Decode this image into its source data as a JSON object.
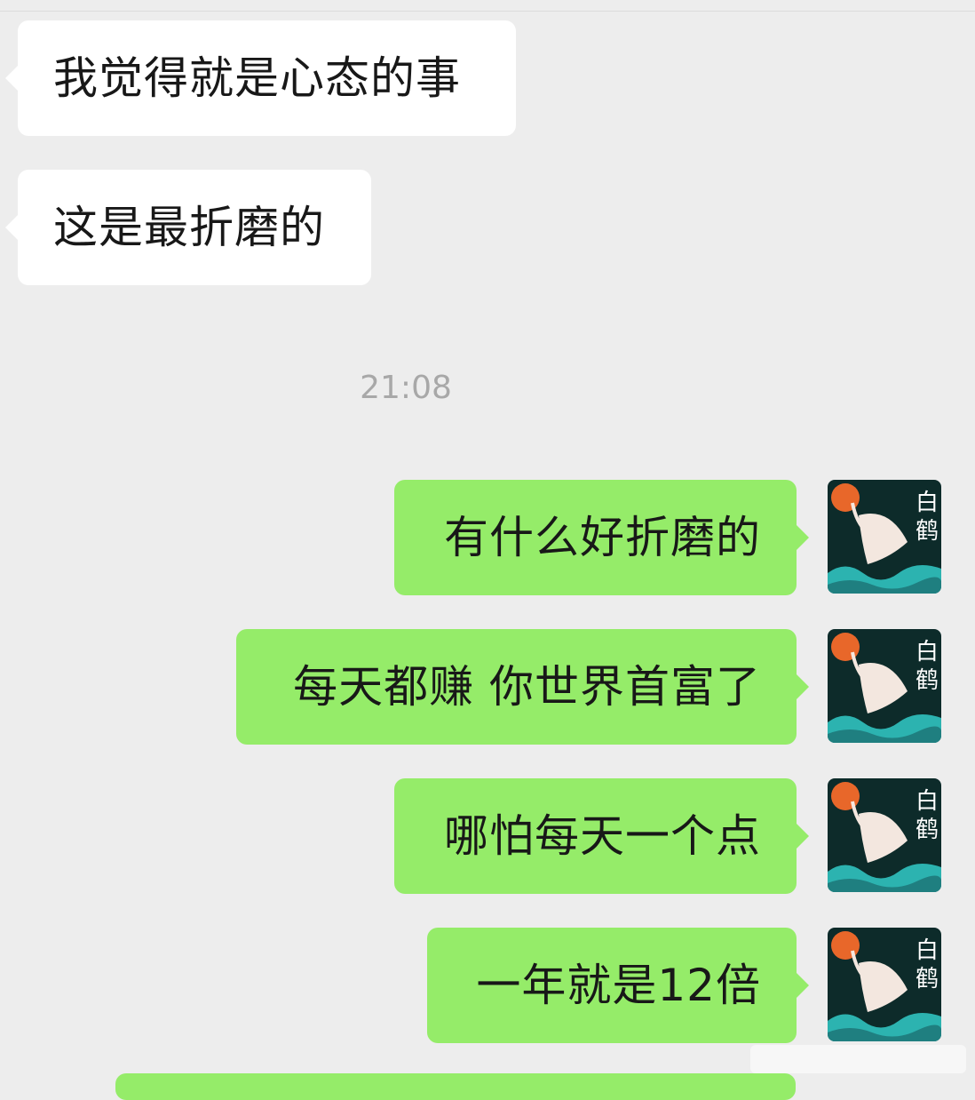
{
  "messages": [
    {
      "from": "other",
      "text": "我觉得就是心态的事"
    },
    {
      "from": "other",
      "text": "这是最折磨的"
    },
    {
      "from": "me",
      "text": "有什么好折磨的"
    },
    {
      "from": "me",
      "text": "每天都赚 你世界首富了"
    },
    {
      "from": "me",
      "text": "哪怕每天一个点"
    },
    {
      "from": "me",
      "text": "一年就是12倍"
    }
  ],
  "timestamp": "21:08",
  "avatar": {
    "text": "白鹤",
    "colors": {
      "bg": "#0d2b2a",
      "sun": "#e8672a",
      "wave": "#2cb3b0",
      "crane": "#f3e7df"
    }
  },
  "watermark": "",
  "colors": {
    "background": "#ededed",
    "incoming": "#ffffff",
    "outgoing": "#95ec69"
  }
}
